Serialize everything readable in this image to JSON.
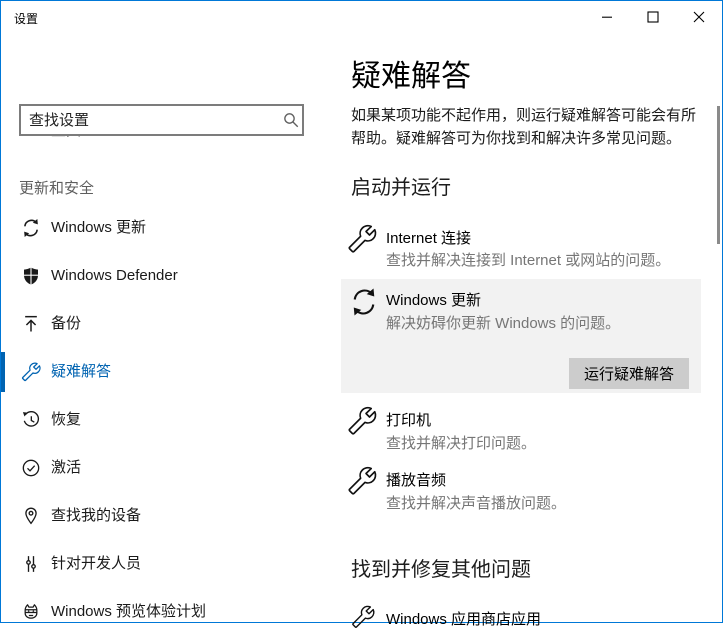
{
  "window": {
    "title": "设置"
  },
  "sidebar": {
    "home_label": "主页",
    "search_placeholder": "查找设置",
    "section_header": "更新和安全",
    "items": [
      {
        "label": "Windows 更新",
        "icon": "sync-icon",
        "selected": false
      },
      {
        "label": "Windows Defender",
        "icon": "shield-icon",
        "selected": false
      },
      {
        "label": "备份",
        "icon": "upload-arrow-icon",
        "selected": false
      },
      {
        "label": "疑难解答",
        "icon": "wrench-icon",
        "selected": true
      },
      {
        "label": "恢复",
        "icon": "history-icon",
        "selected": false
      },
      {
        "label": "激活",
        "icon": "check-circle-icon",
        "selected": false
      },
      {
        "label": "查找我的设备",
        "icon": "map-pin-icon",
        "selected": false
      },
      {
        "label": "针对开发人员",
        "icon": "developer-icon",
        "selected": false
      },
      {
        "label": "Windows 预览体验计划",
        "icon": "ninja-cat-icon",
        "selected": false
      }
    ]
  },
  "main": {
    "title": "疑难解答",
    "description": "如果某项功能不起作用，则运行疑难解答可能会有所帮助。疑难解答可为你找到和解决许多常见问题。",
    "sections": [
      {
        "header": "启动并运行",
        "items": [
          {
            "title": "Internet 连接",
            "subtitle": "查找并解决连接到 Internet 或网站的问题。",
            "icon": "wrench-icon",
            "expanded": false
          },
          {
            "title": "Windows 更新",
            "subtitle": "解决妨碍你更新 Windows 的问题。",
            "icon": "sync-icon",
            "expanded": true,
            "button_label": "运行疑难解答"
          },
          {
            "title": "打印机",
            "subtitle": "查找并解决打印问题。",
            "icon": "wrench-icon",
            "expanded": false
          },
          {
            "title": "播放音频",
            "subtitle": "查找并解决声音播放问题。",
            "icon": "wrench-icon",
            "expanded": false
          }
        ]
      },
      {
        "header": "找到并修复其他问题",
        "items": [
          {
            "title": "Windows 应用商店应用",
            "icon": "wrench-icon",
            "expanded": false
          }
        ]
      }
    ]
  },
  "colors": {
    "accent": "#0063b1",
    "window_border": "#0078d7",
    "highlight_card_bg": "#f2f2f2",
    "button_bg": "#cccccc",
    "subtitle_text": "#767676",
    "sidebar_section_header": "#5e5e5e",
    "scrollbar_thumb": "#8a8a8a"
  }
}
